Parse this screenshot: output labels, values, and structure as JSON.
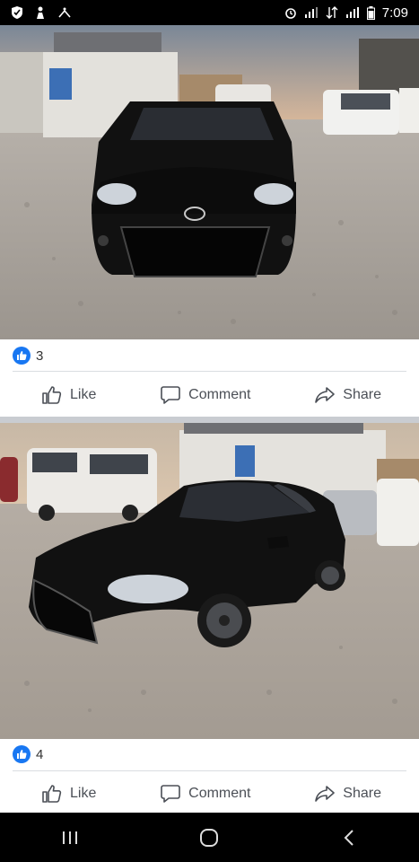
{
  "status_bar": {
    "time": "7:09",
    "left_icons": [
      "shield-icon",
      "notification-icon",
      "wifi-calling-icon"
    ],
    "right_icons": [
      "alarm-icon",
      "signal-icon",
      "data-icon",
      "signal-icon",
      "battery-icon"
    ]
  },
  "posts": [
    {
      "photo_label": "black-sedan-front-view",
      "reaction_count": "3",
      "actions": {
        "like": "Like",
        "comment": "Comment",
        "share": "Share"
      }
    },
    {
      "photo_label": "black-sedan-side-view",
      "reaction_count": "4",
      "actions": {
        "like": "Like",
        "comment": "Comment",
        "share": "Share"
      }
    }
  ],
  "colors": {
    "accent": "#1877f2",
    "action_text": "#4b4f56",
    "status_bar": "#000000",
    "nav_bar": "#000000"
  },
  "nav_bar": {
    "buttons": [
      "recent-apps-icon",
      "home-icon",
      "back-icon"
    ]
  }
}
